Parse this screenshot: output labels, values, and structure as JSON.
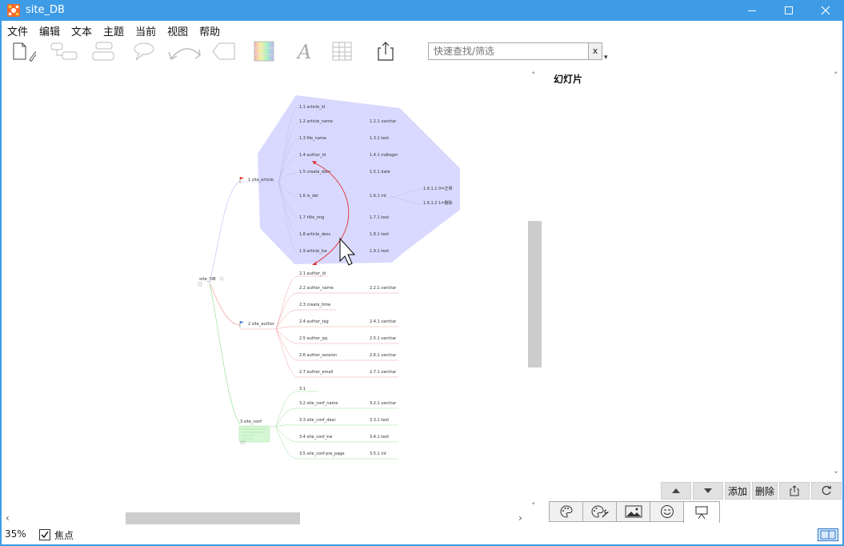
{
  "window": {
    "title": "site_DB",
    "minimize_icon": "minimize-icon",
    "maximize_icon": "maximize-icon",
    "close_icon": "close-icon"
  },
  "menu": [
    "文件",
    "编辑",
    "文本",
    "主题",
    "当前",
    "视图",
    "帮助"
  ],
  "toolbar": {
    "icons": [
      "new-document-icon",
      "add-child-icon",
      "add-sibling-icon",
      "callout-icon",
      "connection-icon",
      "boundary-icon",
      "theme-colors-icon",
      "font-icon",
      "table-icon",
      "export-icon"
    ]
  },
  "search": {
    "placeholder": "快速查找/筛选",
    "clear_label": "x",
    "menu_glyph": "▾"
  },
  "mindmap": {
    "root": "site_DB",
    "branches": [
      {
        "label": "1 site_article",
        "color": "#b3b3f0",
        "items": [
          {
            "key": "1.1 article_id",
            "type": ""
          },
          {
            "key": "1.2 article_name",
            "type": "1.2.1 varchar"
          },
          {
            "key": "1.3 file_name",
            "type": "1.3.1 text"
          },
          {
            "key": "1.4 author_id",
            "type": "1.4.1 indteger"
          },
          {
            "key": "1.5 create_date",
            "type": "1.5.1 date"
          },
          {
            "key": "1.6 is_del",
            "type": "1.6.1 int"
          },
          {
            "key": "1.7 title_img",
            "type": "1.7.1 text"
          },
          {
            "key": "1.8 article_desc",
            "type": "1.8.1 text"
          },
          {
            "key": "1.9 article_kw",
            "type": "1.9.1 text"
          }
        ],
        "sub": [
          "1.6.1.1 0=正常",
          "1.6.1.2 1=删除"
        ]
      },
      {
        "label": "2 site_author",
        "color": "#f3a0a0",
        "items": [
          {
            "key": "2.1 author_id",
            "type": ""
          },
          {
            "key": "2.2 author_name",
            "type": "2.2.1 varchar"
          },
          {
            "key": "2.3 create_time",
            "type": ""
          },
          {
            "key": "2.4 author_tag",
            "type": "2.4.1 varchar"
          },
          {
            "key": "2.5 author_qq",
            "type": "2.5.1 varchar"
          },
          {
            "key": "2.6 author_session",
            "type": "2.6.1 varchar"
          },
          {
            "key": "2.7 author_email",
            "type": "2.7.1 varchar"
          }
        ]
      },
      {
        "label": "3 site_conf",
        "color": "#9be39b",
        "items": [
          {
            "key": "3.1",
            "type": ""
          },
          {
            "key": "3.2 site_conf_name",
            "type": "3.2.1 varchar"
          },
          {
            "key": "3.3 site_conf_desc",
            "type": "3.3.1 text"
          },
          {
            "key": "3.4 site_conf_kw",
            "type": "3.4.1 text"
          },
          {
            "key": "3.5 site_conf-pre_page",
            "type": "3.5.1 int"
          }
        ]
      }
    ]
  },
  "status": {
    "zoom": "35%",
    "focus_label": "焦点",
    "focus_checked": true
  },
  "panel": {
    "title": "幻灯片",
    "buttons": {
      "add": "添加",
      "delete": "删除"
    },
    "tabs": [
      "palette-icon",
      "palette-wrench-icon",
      "image-icon",
      "emoji-icon",
      "slides-icon"
    ]
  }
}
